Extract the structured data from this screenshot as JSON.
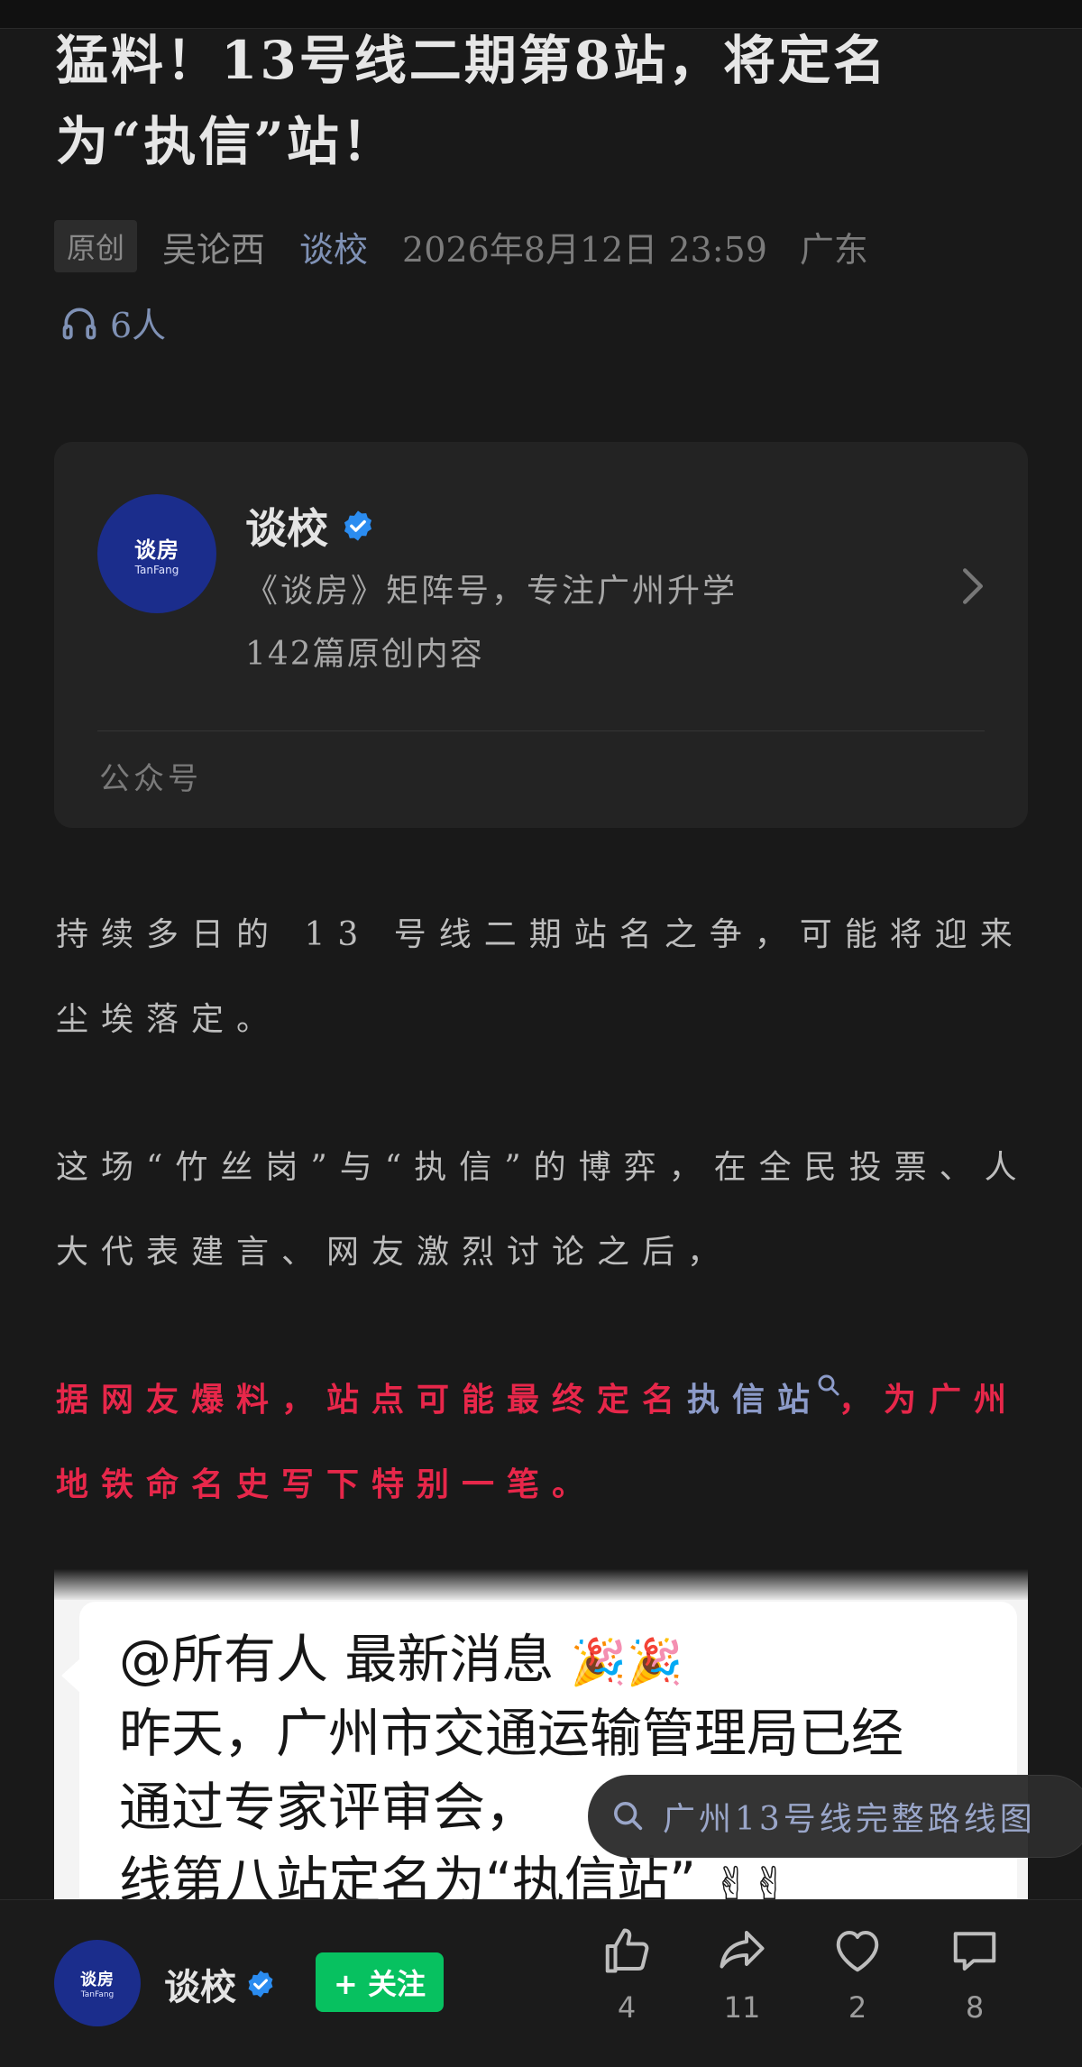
{
  "article": {
    "title": "猛料！13号线二期第8站，将定名为“执信”站！",
    "original_badge": "原创",
    "author": "吴论西",
    "account_link": "谈校",
    "date": "2026年8月12日 23:59",
    "region": "广东",
    "listeners": "6人"
  },
  "account_card": {
    "logo_text": "谈房",
    "logo_sub": "TanFang",
    "name": "谈校",
    "description": "《谈房》矩阵号，专注广州升学",
    "article_count": "142篇原创内容",
    "type_label": "公众号"
  },
  "body": {
    "p1": "持续多日的 13 号线二期站名之争，可能将迎来尘埃落定。",
    "p2": "这场“竹丝岗”与“执信”的博弈，在全民投票、人大代表建言、网友激烈讨论之后，",
    "p3_before": "据网友爆料，站点可能最终定名",
    "p3_link": "执信站",
    "p3_after": "，为广州地铁命名史写下特别一笔。"
  },
  "image": {
    "line1": "@所有人 最新消息",
    "line1_emoji": "🎉🎉",
    "line2": "昨天，广州市交通运输管理局已经",
    "line3": "通过专家评审会，",
    "line4": "线第八站定名为“执信站”",
    "line4_emoji": "✌✌"
  },
  "search_suggestion": "广州13号线完整路线图",
  "bottom_bar": {
    "account_name": "谈校",
    "follow_label": "+ 关注",
    "likes": "4",
    "shares": "11",
    "favorites": "2",
    "comments": "8"
  },
  "colors": {
    "background": "#191919",
    "highlight_red": "#e7274a",
    "link_blue": "#7f91b5",
    "follow_green": "#07c160",
    "avatar_blue": "#1b2d8c"
  },
  "icons": [
    "headphones-icon",
    "verified-icon",
    "chevron-right-icon",
    "search-icon",
    "thumbs-up-icon",
    "share-icon",
    "heart-icon",
    "comment-icon"
  ]
}
